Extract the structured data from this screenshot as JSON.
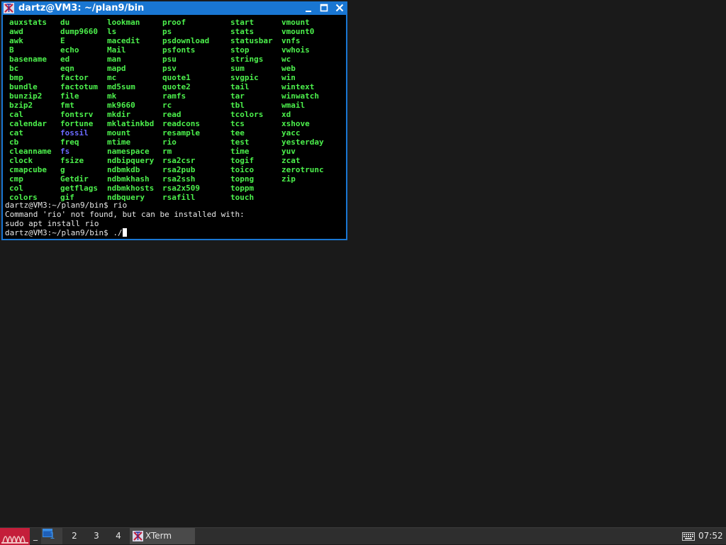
{
  "window": {
    "title": "dartz@VM3: ~/plan9/bin",
    "icon": "xterm-icon",
    "title_color": "#1976d2"
  },
  "terminal": {
    "file_color": "#4cf04c",
    "dir_color": "#6a6aff",
    "columns": [
      [
        "auxstats",
        "awd",
        "awk",
        "B",
        "basename",
        "bc",
        "bmp",
        "bundle",
        "bunzip2",
        "bzip2",
        "cal",
        "calendar",
        "cat",
        "cb",
        "cleanname",
        "clock",
        "cmapcube",
        "cmp",
        "col",
        "colors"
      ],
      [
        "du",
        "dump9660",
        "E",
        "echo",
        "ed",
        "eqn",
        "factor",
        "factotum",
        "file",
        "fmt",
        "fontsrv",
        "fortune",
        "fossil",
        "freq",
        "fs",
        "fsize",
        "g",
        "Getdir",
        "getflags",
        "gif"
      ],
      [
        "lookman",
        "ls",
        "macedit",
        "Mail",
        "man",
        "mapd",
        "mc",
        "md5sum",
        "mk",
        "mk9660",
        "mkdir",
        "mklatinkbd",
        "mount",
        "mtime",
        "namespace",
        "ndbipquery",
        "ndbmkdb",
        "ndbmkhash",
        "ndbmkhosts",
        "ndbquery"
      ],
      [
        "proof",
        "ps",
        "psdownload",
        "psfonts",
        "psu",
        "psv",
        "quote1",
        "quote2",
        "ramfs",
        "rc",
        "read",
        "readcons",
        "resample",
        "rio",
        "rm",
        "rsa2csr",
        "rsa2pub",
        "rsa2ssh",
        "rsa2x509",
        "rsafill"
      ],
      [
        "start",
        "stats",
        "statusbar",
        "stop",
        "strings",
        "sum",
        "svgpic",
        "tail",
        "tar",
        "tbl",
        "tcolors",
        "tcs",
        "tee",
        "test",
        "time",
        "togif",
        "toico",
        "topng",
        "toppm",
        "touch"
      ],
      [
        "vmount",
        "vmount0",
        "vnfs",
        "vwhois",
        "wc",
        "web",
        "win",
        "wintext",
        "winwatch",
        "wmail",
        "xd",
        "xshove",
        "yacc",
        "yesterday",
        "yuv",
        "zcat",
        "zerotrunc",
        "zip"
      ]
    ],
    "dir_entries": [
      "fossil",
      "fs"
    ],
    "lines": [
      "dartz@VM3:~/plan9/bin$ rio",
      "Command 'rio' not found, but can be installed with:",
      "sudo apt install rio"
    ],
    "prompt": "dartz@VM3:~/plan9/bin$ ./"
  },
  "taskbar": {
    "start_icon": "plan9-menu-icon",
    "show_desktop_label": "_",
    "workspaces": [
      "1",
      "2",
      "3",
      "4"
    ],
    "active_workspace": "1",
    "task_label": "XTerm",
    "task_icon": "xterm-icon",
    "keyboard_icon": "keyboard-icon",
    "clock": "07:52"
  }
}
